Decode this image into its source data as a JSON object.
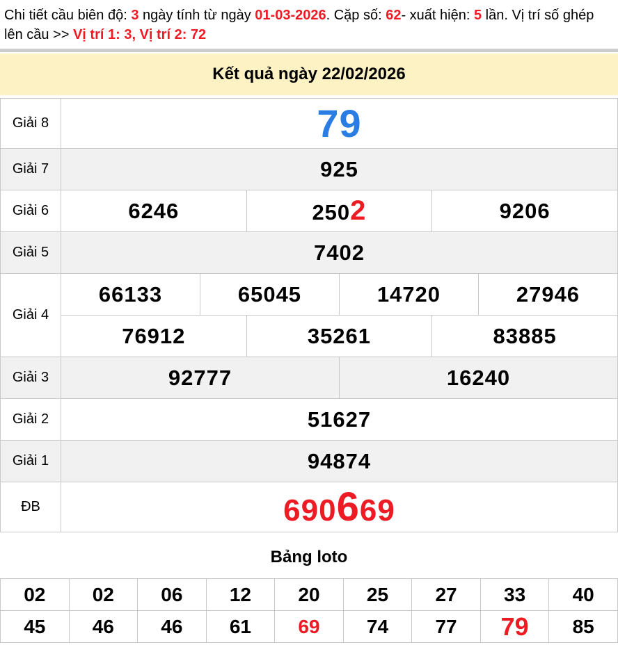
{
  "colors": {
    "red": "#ed1c24",
    "blue": "#2a7de2",
    "banner_bg": "#fdf2c3",
    "stripe_bg": "#f1f1f1",
    "divider": "#cdcdcd",
    "border": "#c8c8c8"
  },
  "header": {
    "parts": [
      {
        "text": "Chi tiết cầu biên độ: ",
        "style": "black"
      },
      {
        "text": "3",
        "style": "red-bold"
      },
      {
        "text": " ngày tính từ ngày ",
        "style": "black"
      },
      {
        "text": "01-03-2026",
        "style": "red-bold"
      },
      {
        "text": ". Cặp số: ",
        "style": "black"
      },
      {
        "text": "62",
        "style": "red-bold"
      },
      {
        "text": "- xuất hiện: ",
        "style": "black"
      },
      {
        "text": "5",
        "style": "red-bold"
      },
      {
        "text": " lần. Vị trí số ghép lên cầu >> ",
        "style": "black"
      },
      {
        "text": "Vị trí 1: 3, Vị trí 2: 72",
        "style": "red-bold"
      }
    ]
  },
  "banner": {
    "title": "Kết quả ngày 22/02/2026"
  },
  "results": {
    "rows": [
      {
        "label": "Giải 8",
        "label_rowspan": 1,
        "bg": "white",
        "cells": [
          {
            "span": 12,
            "segments": [
              {
                "t": "79",
                "s": "blue"
              }
            ]
          }
        ]
      },
      {
        "label": "Giải 7",
        "label_rowspan": 1,
        "bg": "gray",
        "cells": [
          {
            "span": 12,
            "segments": [
              {
                "t": "925",
                "s": "n"
              }
            ]
          }
        ]
      },
      {
        "label": "Giải 6",
        "label_rowspan": 1,
        "bg": "white",
        "cells": [
          {
            "span": 4,
            "segments": [
              {
                "t": "6246",
                "s": "n"
              }
            ]
          },
          {
            "span": 4,
            "segments": [
              {
                "t": "250",
                "s": "n"
              },
              {
                "t": "2",
                "s": "red-sm"
              }
            ]
          },
          {
            "span": 4,
            "segments": [
              {
                "t": "9206",
                "s": "n"
              }
            ]
          }
        ]
      },
      {
        "label": "Giải 5",
        "label_rowspan": 1,
        "bg": "gray",
        "cells": [
          {
            "span": 12,
            "segments": [
              {
                "t": "7402",
                "s": "n"
              }
            ]
          }
        ]
      },
      {
        "label": "Giải 4",
        "label_rowspan": 2,
        "bg": "white",
        "cells": [
          {
            "span": 3,
            "segments": [
              {
                "t": "66133",
                "s": "n"
              }
            ]
          },
          {
            "span": 3,
            "segments": [
              {
                "t": "65045",
                "s": "n"
              }
            ]
          },
          {
            "span": 3,
            "segments": [
              {
                "t": "14720",
                "s": "n"
              }
            ]
          },
          {
            "span": 3,
            "segments": [
              {
                "t": "27946",
                "s": "n"
              }
            ]
          }
        ]
      },
      {
        "label": null,
        "label_rowspan": 1,
        "bg": "white",
        "cells": [
          {
            "span": 4,
            "segments": [
              {
                "t": "76912",
                "s": "n"
              }
            ]
          },
          {
            "span": 4,
            "segments": [
              {
                "t": "35261",
                "s": "n"
              }
            ]
          },
          {
            "span": 4,
            "segments": [
              {
                "t": "83885",
                "s": "n"
              }
            ]
          }
        ]
      },
      {
        "label": "Giải 3",
        "label_rowspan": 1,
        "bg": "gray",
        "cells": [
          {
            "span": 6,
            "segments": [
              {
                "t": "92777",
                "s": "n"
              }
            ]
          },
          {
            "span": 6,
            "segments": [
              {
                "t": "16240",
                "s": "n"
              }
            ]
          }
        ]
      },
      {
        "label": "Giải 2",
        "label_rowspan": 1,
        "bg": "white",
        "cells": [
          {
            "span": 12,
            "segments": [
              {
                "t": "51627",
                "s": "n"
              }
            ]
          }
        ]
      },
      {
        "label": "Giải 1",
        "label_rowspan": 1,
        "bg": "gray",
        "cells": [
          {
            "span": 12,
            "segments": [
              {
                "t": "94874",
                "s": "n"
              }
            ]
          }
        ]
      },
      {
        "label": "ĐB",
        "label_rowspan": 1,
        "bg": "white",
        "cells": [
          {
            "span": 12,
            "segments": [
              {
                "t": "690",
                "s": "red"
              },
              {
                "t": "6",
                "s": "red-xl"
              },
              {
                "t": "69",
                "s": "red"
              }
            ]
          }
        ]
      }
    ]
  },
  "loto": {
    "title": "Bảng loto",
    "rows": [
      [
        {
          "t": "02",
          "s": "n"
        },
        {
          "t": "02",
          "s": "n"
        },
        {
          "t": "06",
          "s": "n"
        },
        {
          "t": "12",
          "s": "n"
        },
        {
          "t": "20",
          "s": "n"
        },
        {
          "t": "25",
          "s": "n"
        },
        {
          "t": "27",
          "s": "n"
        },
        {
          "t": "33",
          "s": "n"
        },
        {
          "t": "40",
          "s": "n"
        }
      ],
      [
        {
          "t": "45",
          "s": "n"
        },
        {
          "t": "46",
          "s": "n"
        },
        {
          "t": "46",
          "s": "n"
        },
        {
          "t": "61",
          "s": "n"
        },
        {
          "t": "69",
          "s": "red"
        },
        {
          "t": "74",
          "s": "n"
        },
        {
          "t": "77",
          "s": "n"
        },
        {
          "t": "79",
          "s": "red-lg"
        },
        {
          "t": "85",
          "s": "n"
        }
      ]
    ]
  }
}
